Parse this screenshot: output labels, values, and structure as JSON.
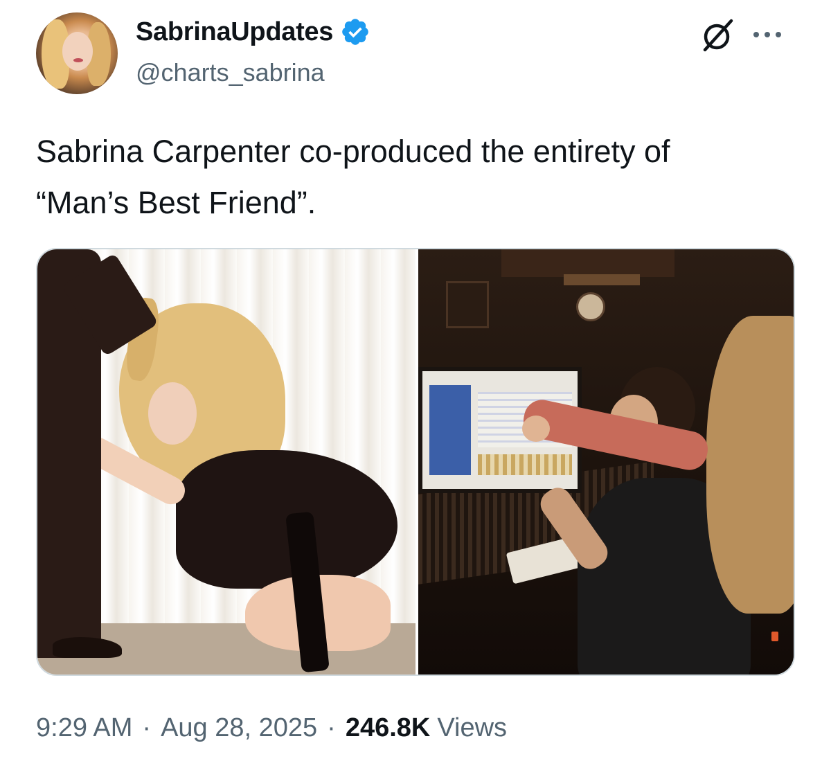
{
  "author": {
    "display_name": "SabrinaUpdates",
    "handle": "@charts_sabrina",
    "verified": true
  },
  "tweet": {
    "text_line1": "Sabrina Carpenter co-produced the entirety of",
    "text_line2": "“Man’s Best Friend”."
  },
  "media": {
    "images": [
      {
        "description_icon": "photo-left"
      },
      {
        "description_icon": "photo-right"
      }
    ]
  },
  "meta": {
    "time": "9:29 AM",
    "separator": "·",
    "date": "Aug 28, 2025",
    "views_count": "246.8K",
    "views_label": "Views"
  },
  "colors": {
    "verified_blue": "#1d9bf0",
    "secondary_text": "#536471",
    "primary_text": "#0f1419"
  },
  "icons": {
    "verified": "verified-badge-icon",
    "grok": "grok-icon",
    "more": "more-options-icon"
  }
}
